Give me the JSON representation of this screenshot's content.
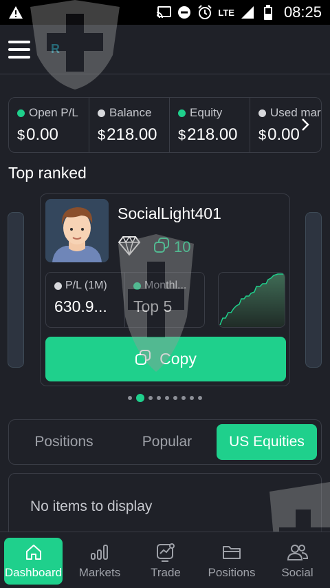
{
  "status_bar": {
    "network": "LTE",
    "time": "08:25",
    "icons": [
      "warning-icon",
      "cast-icon",
      "dnd-icon",
      "alarm-icon",
      "signal-icon",
      "battery-icon"
    ]
  },
  "header": {
    "logo_text": "R"
  },
  "account_stats": [
    {
      "label": "Open P/L",
      "currency": "$",
      "value": "0.00",
      "dot": "green"
    },
    {
      "label": "Balance",
      "currency": "$",
      "value": "218.00",
      "dot": "grey"
    },
    {
      "label": "Equity",
      "currency": "$",
      "value": "218.00",
      "dot": "green"
    },
    {
      "label": "Used mar",
      "currency": "$",
      "value": "0.00",
      "dot": "grey"
    }
  ],
  "top_ranked": {
    "title": "Top ranked",
    "trader": {
      "name": "SocialLight401",
      "copiers": "10",
      "pl_label": "P/L (1M)",
      "pl_value": "630.9...",
      "monthly_label": "Monthl...",
      "monthly_value": "Top 5",
      "copy_label": "Copy"
    },
    "pages_total": 9,
    "page_active": 2
  },
  "tabs": [
    {
      "label": "Positions",
      "active": false
    },
    {
      "label": "Popular",
      "active": false
    },
    {
      "label": "US Equities",
      "active": true
    }
  ],
  "empty_message": "No items to display",
  "bottom_nav": [
    {
      "label": "Dashboard",
      "icon": "home-icon",
      "active": true
    },
    {
      "label": "Markets",
      "icon": "bars-icon",
      "active": false
    },
    {
      "label": "Trade",
      "icon": "trade-icon",
      "active": false
    },
    {
      "label": "Positions",
      "icon": "folder-icon",
      "active": false
    },
    {
      "label": "Social",
      "icon": "people-icon",
      "active": false
    }
  ],
  "colors": {
    "accent": "#1fd08c",
    "background": "#1f2128",
    "border": "#3a3d46"
  }
}
